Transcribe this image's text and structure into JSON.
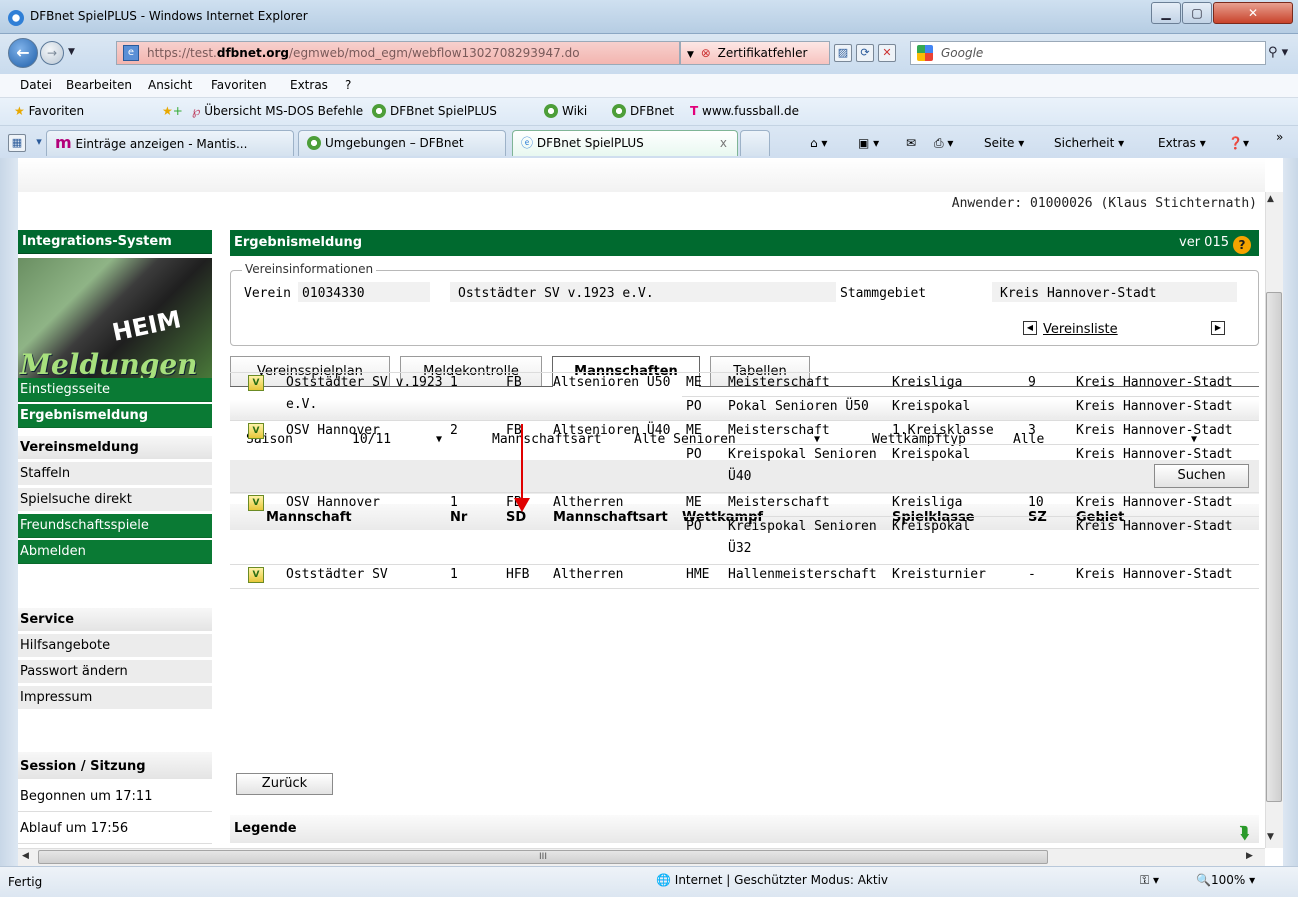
{
  "window": {
    "title": "DFBnet SpielPLUS - Windows Internet Explorer"
  },
  "address": {
    "url_prefix": "https://test.",
    "url_domain": "dfbnet.org",
    "url_rest": "/egmweb/mod_egm/webflow1302708293947.do",
    "cert_error": "Zertifikatfehler",
    "search_placeholder": "Google"
  },
  "menubar": [
    "Datei",
    "Bearbeiten",
    "Ansicht",
    "Favoriten",
    "Extras",
    "?"
  ],
  "favorites": {
    "label": "Favoriten",
    "items": [
      "Übersicht MS-DOS Befehle",
      "DFBnet SpielPLUS",
      "Wiki",
      "DFBnet",
      "www.fussball.de"
    ]
  },
  "browser_tabs": [
    "Einträge anzeigen - Mantis...",
    "Umgebungen – DFBnet",
    "DFBnet SpielPLUS"
  ],
  "command_bar": [
    "Seite ▾",
    "Sicherheit ▾",
    "Extras ▾"
  ],
  "user_info": "Anwender: 01000026 (Klaus Stichternath)",
  "sidebar": {
    "system_header": "Integrations-System",
    "banner_heim": "HEIM",
    "banner_meldungen": "Meldungen",
    "nav": [
      "Einstiegsseite",
      "Ergebnismeldung",
      "Vereinsmeldung",
      "Staffeln",
      "Spielsuche direkt",
      "Freundschaftsspiele",
      "Abmelden"
    ],
    "service_header": "Service",
    "service_items": [
      "Hilfsangebote",
      "Passwort ändern",
      "Impressum"
    ],
    "session_header": "Session / Sitzung",
    "session_items": [
      "Begonnen um 17:11",
      "Ablauf um 17:56"
    ]
  },
  "main": {
    "title": "Ergebnismeldung",
    "version": "ver 015",
    "vereinsinfo": {
      "legend": "Vereinsinformationen",
      "verein_label": "Verein",
      "verein_nr": "01034330",
      "verein_name": "Oststädter SV v.1923 e.V.",
      "stammgebiet_label": "Stammgebiet",
      "stammgebiet": "Kreis Hannover-Stadt",
      "vereinsliste": "Vereinsliste"
    },
    "tabs": [
      "Vereinsspielplan",
      "Meldekontrolle",
      "Mannschaften",
      "Tabellen"
    ],
    "active_tab": "Mannschaften",
    "filter": {
      "saison_label": "Saison",
      "saison_value": "10/11",
      "mannschaftsart_label": "Mannschaftsart",
      "mannschaftsart_value": "Alte Senioren",
      "wettkampftyp_label": "Wettkampftyp",
      "wettkampftyp_value": "Alle",
      "search_button": "Suchen"
    },
    "table": {
      "headers": [
        "Mannschaft",
        "Nr",
        "SD",
        "Mannschaftsart",
        "Wettkampf",
        "Spielklasse",
        "SZ",
        "Gebiet"
      ],
      "rows": [
        {
          "mannschaft": [
            "Oststädter SV v.1923",
            "e.V."
          ],
          "nr": "1",
          "sd": "FB",
          "art": "Altsenioren Ü50",
          "wettkampf": [
            {
              "code": "ME",
              "name": [
                "Meisterschaft"
              ],
              "klasse": "Kreisliga",
              "sz": "9",
              "gebiet": "Kreis Hannover-Stadt"
            },
            {
              "code": "PO",
              "name": [
                "Pokal Senioren Ü50"
              ],
              "klasse": "Kreispokal",
              "sz": "",
              "gebiet": "Kreis Hannover-Stadt"
            }
          ]
        },
        {
          "mannschaft": [
            "OSV Hannover"
          ],
          "nr": "2",
          "sd": "FB",
          "art": "Altsenioren Ü40",
          "wettkampf": [
            {
              "code": "ME",
              "name": [
                "Meisterschaft"
              ],
              "klasse": "1.Kreisklasse",
              "sz": "3",
              "gebiet": "Kreis Hannover-Stadt"
            },
            {
              "code": "PO",
              "name": [
                "Kreispokal Senioren",
                "Ü40"
              ],
              "klasse": "Kreispokal",
              "sz": "",
              "gebiet": "Kreis Hannover-Stadt"
            }
          ]
        },
        {
          "mannschaft": [
            "OSV Hannover"
          ],
          "nr": "1",
          "sd": "FB",
          "art": "Altherren",
          "wettkampf": [
            {
              "code": "ME",
              "name": [
                "Meisterschaft"
              ],
              "klasse": "Kreisliga",
              "sz": "10",
              "gebiet": "Kreis Hannover-Stadt"
            },
            {
              "code": "PO",
              "name": [
                "Kreispokal Senioren",
                "Ü32"
              ],
              "klasse": "Kreispokal",
              "sz": "",
              "gebiet": "Kreis Hannover-Stadt"
            }
          ]
        },
        {
          "mannschaft": [
            "Oststädter SV"
          ],
          "nr": "1",
          "sd": "HFB",
          "art": "Altherren",
          "wettkampf": [
            {
              "code": "HME",
              "name": [
                "Hallenmeisterschaft"
              ],
              "klasse": "Kreisturnier",
              "sz": "-",
              "gebiet": "Kreis Hannover-Stadt"
            }
          ]
        }
      ]
    },
    "back_button": "Zurück",
    "legend_section": "Legende"
  },
  "status": {
    "left": "Fertig",
    "zone": "Internet | Geschützter Modus: Aktiv",
    "zoom": "100%"
  }
}
